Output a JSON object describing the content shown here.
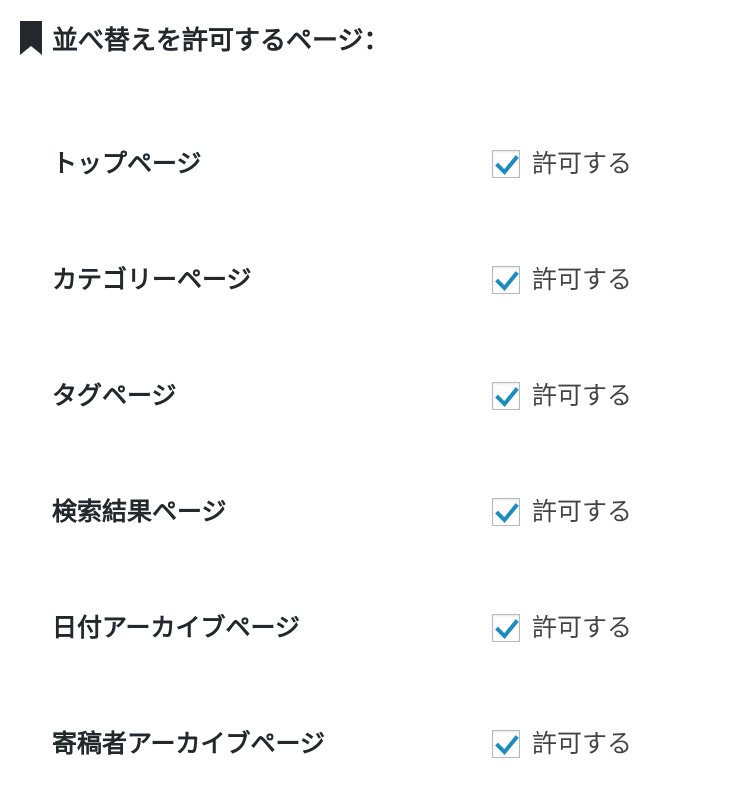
{
  "section": {
    "title": "並べ替えを許可するページ：",
    "icon": "bookmark-icon"
  },
  "accent_color": "#1e8cbe",
  "rows": [
    {
      "label": "トップページ",
      "checkbox_label": "許可する",
      "checked": true
    },
    {
      "label": "カテゴリーページ",
      "checkbox_label": "許可する",
      "checked": true
    },
    {
      "label": "タグページ",
      "checkbox_label": "許可する",
      "checked": true
    },
    {
      "label": "検索結果ページ",
      "checkbox_label": "許可する",
      "checked": true
    },
    {
      "label": "日付アーカイブページ",
      "checkbox_label": "許可する",
      "checked": true
    },
    {
      "label": "寄稿者アーカイブページ",
      "checkbox_label": "許可する",
      "checked": true
    }
  ]
}
